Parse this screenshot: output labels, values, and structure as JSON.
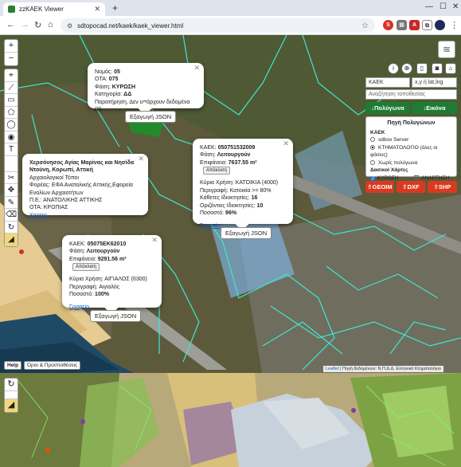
{
  "browser": {
    "tab_title": "zzKAEK Viewer",
    "url": "sdtopocad.net/kaek/kaek_viewer.html"
  },
  "popup_top": {
    "nomos_label": "Νομός:",
    "nomos": "05",
    "ota_label": "ΟΤΑ:",
    "ota": "075",
    "fasi_label": "Φάση:",
    "fasi": "ΚΥΡΩΣΗ",
    "kat_label": "Κατηγορία:",
    "kat": "ΔΔ",
    "note": "Παρατήρηση, Δεν υπάρχουν δεδομένα (0)",
    "json_button": "Εξαγωγή JSON"
  },
  "popup_archaeo": {
    "title": "Χερσόνησος Αγίας Μαρίνας και Νησίδα Ντούνη, Κορωπί, Αττική",
    "type": "Αρχαιολογικοί Τόποι",
    "foreas": "Φορέας: ΕΦΑ Ανατολικής Αττικής,Εφορεία Εναλίων Αρχαιοτήτων",
    "pe": "Π.Ε.: ΑΝΑΤΟΛΙΚΗΣ ΑΤΤΙΚΗΣ",
    "ota": "ΟΤΑ: ΚΡΩΠΙΑΣ",
    "link": "Χαρτης"
  },
  "popup_center": {
    "kaek_label": "ΚΑΕΚ:",
    "kaek": "050751532009",
    "fasi_label": "Φάση:",
    "fasi": "Λειτουργούν",
    "area_label": "Επιφάνεια:",
    "area": "7637.55 m²",
    "copy_button": "Απόκλιση",
    "use_label": "Κύρια Χρήση:",
    "use": "ΚΑΤΟΙΚΙΑ (4000)",
    "desc_label": "Περιγραφή:",
    "desc": "Κατοικία >= 80%",
    "vert_label": "Κάθετες Ιδιοκτησίες:",
    "vert": "16",
    "horiz_label": "Οριζόντιες Ιδιοκτησίες:",
    "horiz": "10",
    "pct_label": "Ποσοστό:",
    "pct": "96%",
    "link": "Γραφείο",
    "json_button": "Εξαγωγή JSON"
  },
  "popup_bottom": {
    "kaek_label": "ΚΑΕΚ:",
    "kaek": "05075ΕΚ62010",
    "fasi_label": "Φάση:",
    "fasi": "Λειτουργούν",
    "area_label": "Επιφάνεια:",
    "area": "9291.56 m²",
    "copy_button": "Απόκλιση",
    "use_label": "Κύρια Χρήση:",
    "use": "ΑΙΓΙΑΛΟΣ (6300)",
    "desc_label": "Περιγραφή:",
    "desc": "Αιγιαλός",
    "pct_label": "Ποσοστό:",
    "pct": "100%",
    "link": "Γραφείο",
    "json_button": "Εξαγωγή JSON"
  },
  "right_panel": {
    "kaek_field": "ΚΑΕΚ",
    "coord_field": "x,y ή lat,lng",
    "search_placeholder": "Αναζήτηση τοποθεσίας",
    "polygons_button": "↓Πολύγωνα",
    "image_button": "↓Εικόνα",
    "source_head": "Πηγή Πολυγώνων",
    "kaek_head": "ΚΑΕΚ",
    "opt1": "sdbox Server",
    "opt2": "ΚΤΗΜΑΤΟΛΟΓΙΟ (όλες οι φάσεις)",
    "opt3": "Χωρίς πολύγωνα",
    "forest_head": "Δασικοί Χάρτες",
    "chk1": "ΚΥΡΩΣΗ",
    "chk2": "ΑΝΑΡΤΗΣΗ",
    "geoim": "⇧GEOIM",
    "dxf": "⇧DXF",
    "shp": "⇧SHP"
  },
  "bottom": {
    "help": "Help",
    "terms": "Όροι & Προϋποθέσεις",
    "attrib_leaflet": "Leaflet",
    "attrib_text": "| Πηγή δεδομένων: Ν.Π.Δ.Δ. Ελληνικό Κτηματολόγιο"
  },
  "colors": {
    "accent_green": "#1e7b34",
    "accent_red": "#d93a1f",
    "parcel_line": "#3ee6d0"
  }
}
